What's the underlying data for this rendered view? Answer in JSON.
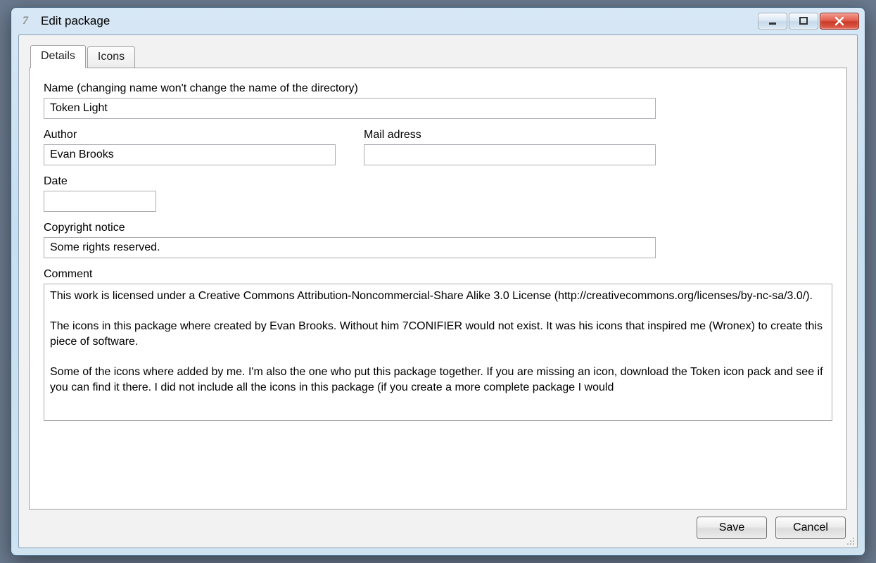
{
  "window": {
    "title": "Edit package"
  },
  "tabs": {
    "details": "Details",
    "icons": "Icons"
  },
  "labels": {
    "name": "Name (changing name won't change the name of the directory)",
    "author": "Author",
    "mail": "Mail adress",
    "date": "Date",
    "copyright": "Copyright notice",
    "comment": "Comment"
  },
  "fields": {
    "name": "Token Light",
    "author": "Evan Brooks",
    "mail": "",
    "date": "",
    "copyright": "Some rights reserved.",
    "comment": "This work is licensed under a Creative Commons Attribution-Noncommercial-Share Alike 3.0 License (http://creativecommons.org/licenses/by-nc-sa/3.0/).\n\nThe icons in this package where created by Evan Brooks. Without him 7CONIFIER would not exist. It was his icons that inspired me (Wronex) to create this piece of software.\n\nSome of the icons where added by me. I'm also the one who put this package together. If you are missing an icon, download the Token icon pack and see if you can find it there. I did not include all the icons in this package (if you create a more complete package I would"
  },
  "buttons": {
    "save": "Save",
    "cancel": "Cancel"
  }
}
